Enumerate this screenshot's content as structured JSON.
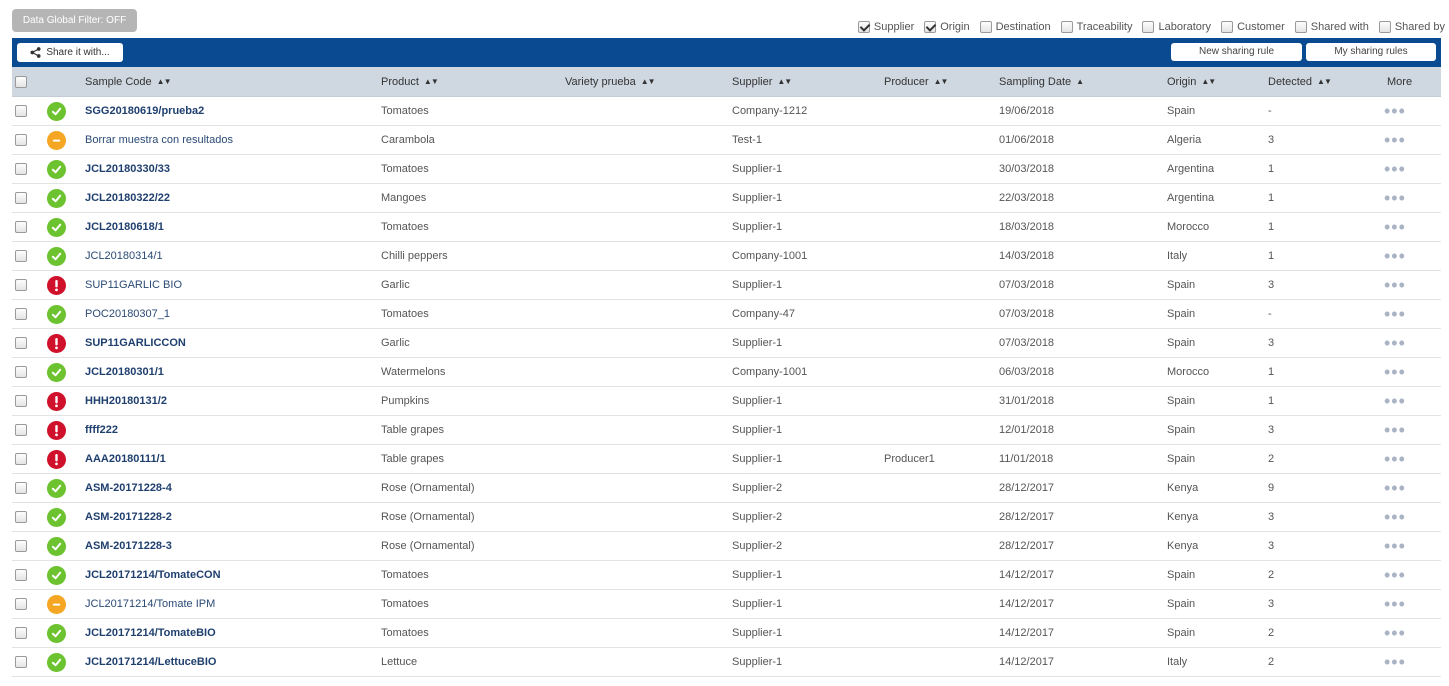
{
  "global_filter": {
    "label": "Data Global Filter: OFF"
  },
  "column_toggles": [
    {
      "label": "Supplier",
      "checked": true
    },
    {
      "label": "Origin",
      "checked": true
    },
    {
      "label": "Destination",
      "checked": false
    },
    {
      "label": "Traceability",
      "checked": false
    },
    {
      "label": "Laboratory",
      "checked": false
    },
    {
      "label": "Customer",
      "checked": false
    },
    {
      "label": "Shared with",
      "checked": false
    },
    {
      "label": "Shared by",
      "checked": false
    }
  ],
  "toolbar": {
    "share_label": "Share it with...",
    "new_rule_label": "New sharing rule",
    "my_rules_label": "My sharing rules",
    "bar_color": "#0a4a91"
  },
  "columns": {
    "sample_code": "Sample Code",
    "product": "Product",
    "variety": "Variety prueba",
    "supplier": "Supplier",
    "producer": "Producer",
    "sampling_date": "Sampling Date",
    "origin": "Origin",
    "detected": "Detected",
    "more": "More"
  },
  "status_colors": {
    "ok": "#6cc32f",
    "warn": "#f5a623",
    "alert": "#d0112b"
  },
  "rows": [
    {
      "status": "ok",
      "bold": true,
      "code": "SGG20180619/prueba2",
      "product": "Tomatoes",
      "variety": "",
      "supplier": "Company-1212",
      "producer": "",
      "date": "19/06/2018",
      "origin": "Spain",
      "detected": "-"
    },
    {
      "status": "warn",
      "bold": false,
      "code": "Borrar muestra con resultados",
      "product": "Carambola",
      "variety": "",
      "supplier": "Test-1",
      "producer": "",
      "date": "01/06/2018",
      "origin": "Algeria",
      "detected": "3"
    },
    {
      "status": "ok",
      "bold": true,
      "code": "JCL20180330/33",
      "product": "Tomatoes",
      "variety": "",
      "supplier": "Supplier-1",
      "producer": "",
      "date": "30/03/2018",
      "origin": "Argentina",
      "detected": "1"
    },
    {
      "status": "ok",
      "bold": true,
      "code": "JCL20180322/22",
      "product": "Mangoes",
      "variety": "",
      "supplier": "Supplier-1",
      "producer": "",
      "date": "22/03/2018",
      "origin": "Argentina",
      "detected": "1"
    },
    {
      "status": "ok",
      "bold": true,
      "code": "JCL20180618/1",
      "product": "Tomatoes",
      "variety": "",
      "supplier": "Supplier-1",
      "producer": "",
      "date": "18/03/2018",
      "origin": "Morocco",
      "detected": "1"
    },
    {
      "status": "ok",
      "bold": false,
      "code": "JCL20180314/1",
      "product": "Chilli peppers",
      "variety": "",
      "supplier": "Company-1001",
      "producer": "",
      "date": "14/03/2018",
      "origin": "Italy",
      "detected": "1"
    },
    {
      "status": "alert",
      "bold": false,
      "code": "SUP11GARLIC BIO",
      "product": "Garlic",
      "variety": "",
      "supplier": "Supplier-1",
      "producer": "",
      "date": "07/03/2018",
      "origin": "Spain",
      "detected": "3"
    },
    {
      "status": "ok",
      "bold": false,
      "code": "POC20180307_1",
      "product": "Tomatoes",
      "variety": "",
      "supplier": "Company-47",
      "producer": "",
      "date": "07/03/2018",
      "origin": "Spain",
      "detected": "-"
    },
    {
      "status": "alert",
      "bold": true,
      "code": "SUP11GARLICCON",
      "product": "Garlic",
      "variety": "",
      "supplier": "Supplier-1",
      "producer": "",
      "date": "07/03/2018",
      "origin": "Spain",
      "detected": "3"
    },
    {
      "status": "ok",
      "bold": true,
      "code": "JCL20180301/1",
      "product": "Watermelons",
      "variety": "",
      "supplier": "Company-1001",
      "producer": "",
      "date": "06/03/2018",
      "origin": "Morocco",
      "detected": "1"
    },
    {
      "status": "alert",
      "bold": true,
      "code": "HHH20180131/2",
      "product": "Pumpkins",
      "variety": "",
      "supplier": "Supplier-1",
      "producer": "",
      "date": "31/01/2018",
      "origin": "Spain",
      "detected": "1"
    },
    {
      "status": "alert",
      "bold": true,
      "code": "ffff222",
      "product": "Table grapes",
      "variety": "",
      "supplier": "Supplier-1",
      "producer": "",
      "date": "12/01/2018",
      "origin": "Spain",
      "detected": "3"
    },
    {
      "status": "alert",
      "bold": true,
      "code": "AAA20180111/1",
      "product": "Table grapes",
      "variety": "",
      "supplier": "Supplier-1",
      "producer": "Producer1",
      "date": "11/01/2018",
      "origin": "Spain",
      "detected": "2"
    },
    {
      "status": "ok",
      "bold": true,
      "code": "ASM-20171228-4",
      "product": "Rose (Ornamental)",
      "variety": "",
      "supplier": "Supplier-2",
      "producer": "",
      "date": "28/12/2017",
      "origin": "Kenya",
      "detected": "9"
    },
    {
      "status": "ok",
      "bold": true,
      "code": "ASM-20171228-2",
      "product": "Rose (Ornamental)",
      "variety": "",
      "supplier": "Supplier-2",
      "producer": "",
      "date": "28/12/2017",
      "origin": "Kenya",
      "detected": "3"
    },
    {
      "status": "ok",
      "bold": true,
      "code": "ASM-20171228-3",
      "product": "Rose (Ornamental)",
      "variety": "",
      "supplier": "Supplier-2",
      "producer": "",
      "date": "28/12/2017",
      "origin": "Kenya",
      "detected": "3"
    },
    {
      "status": "ok",
      "bold": true,
      "code": "JCL20171214/TomateCON",
      "product": "Tomatoes",
      "variety": "",
      "supplier": "Supplier-1",
      "producer": "",
      "date": "14/12/2017",
      "origin": "Spain",
      "detected": "2"
    },
    {
      "status": "warn",
      "bold": false,
      "code": "JCL20171214/Tomate IPM",
      "product": "Tomatoes",
      "variety": "",
      "supplier": "Supplier-1",
      "producer": "",
      "date": "14/12/2017",
      "origin": "Spain",
      "detected": "3"
    },
    {
      "status": "ok",
      "bold": true,
      "code": "JCL20171214/TomateBIO",
      "product": "Tomatoes",
      "variety": "",
      "supplier": "Supplier-1",
      "producer": "",
      "date": "14/12/2017",
      "origin": "Spain",
      "detected": "2"
    },
    {
      "status": "ok",
      "bold": true,
      "code": "JCL20171214/LettuceBIO",
      "product": "Lettuce",
      "variety": "",
      "supplier": "Supplier-1",
      "producer": "",
      "date": "14/12/2017",
      "origin": "Italy",
      "detected": "2"
    }
  ]
}
